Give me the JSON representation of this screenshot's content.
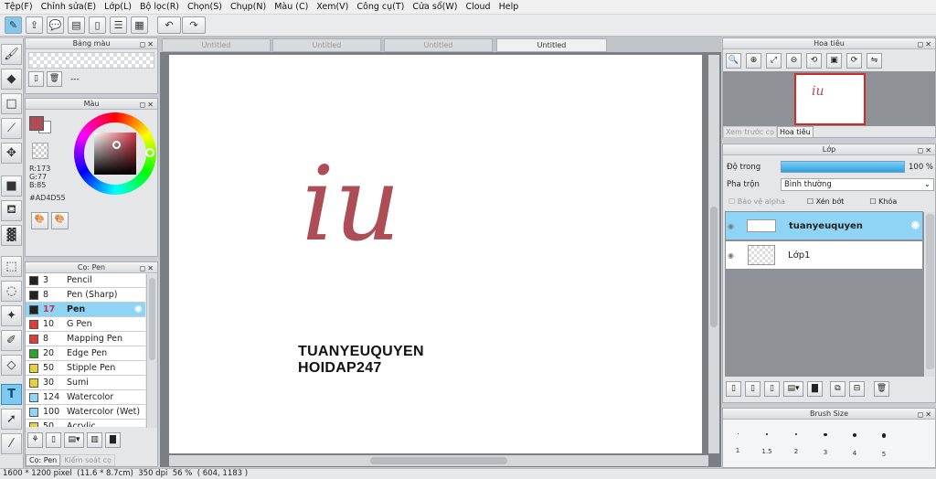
{
  "menu": [
    "Tệp(F)",
    "Chỉnh sửa(E)",
    "Lớp(L)",
    "Bộ lọc(R)",
    "Chọn(S)",
    "Chụp(N)",
    "Màu (C)",
    "Xem(V)",
    "Công cụ(T)",
    "Cửa sổ(W)",
    "Cloud",
    "Help"
  ],
  "doc_tabs": [
    "Untitled",
    "Untitled",
    "Untitled",
    "Untitled"
  ],
  "panels": {
    "swatch_title": "Bảng màu",
    "swatch_info": "---",
    "color_title": "Màu",
    "color_r": "R:173",
    "color_g": "G:77",
    "color_b": "B:85",
    "color_hex": "#AD4D55",
    "brush_title": "Cọ: Pen",
    "navigator_title": "Hoa tiêu",
    "nav_tab1": "Xem trước cọ",
    "nav_tab2": "Hoa tiêu",
    "layer_title": "Lớp",
    "opacity_label": "Độ trong",
    "opacity_value": "100 %",
    "blend_label": "Pha trộn",
    "blend_value": "Bình thường",
    "protect_alpha": "Bảo vệ alpha",
    "clipping": "Xén bớt",
    "lock": "Khóa",
    "brushsize_title": "Brush Size",
    "bottom_tab1": "Cọ: Pen",
    "bottom_tab2": "Kiểm soát cọ"
  },
  "opacity_fraction": 1.0,
  "brushes": [
    {
      "size": "3",
      "name": "Pencil",
      "color": "#222222"
    },
    {
      "size": "8",
      "name": "Pen (Sharp)",
      "color": "#222222"
    },
    {
      "size": "17",
      "name": "Pen",
      "color": "#222222",
      "selected": true
    },
    {
      "size": "10",
      "name": "G Pen",
      "color": "#e03a3a"
    },
    {
      "size": "8",
      "name": "Mapping Pen",
      "color": "#e03a3a"
    },
    {
      "size": "20",
      "name": "Edge Pen",
      "color": "#2fa32f"
    },
    {
      "size": "50",
      "name": "Stipple Pen",
      "color": "#e8d23a"
    },
    {
      "size": "30",
      "name": "Sumi",
      "color": "#e8d23a"
    },
    {
      "size": "124",
      "name": "Watercolor",
      "color": "#8fd6f5"
    },
    {
      "size": "100",
      "name": "Watercolor (Wet)",
      "color": "#8fd6f5"
    },
    {
      "size": "50",
      "name": "Acrylic",
      "color": "#e8d23a"
    }
  ],
  "layers": [
    {
      "name": "tuanyeuquyen",
      "selected": true
    },
    {
      "name": "Lớp1",
      "selected": false
    }
  ],
  "brush_sizes": [
    "1",
    "1.5",
    "2",
    "3",
    "4",
    "5"
  ],
  "canvas_text": {
    "big": "iu",
    "line1": "TUANYEUQUYEN",
    "line2": "HOIDAP247"
  },
  "colors": {
    "main": "#AD4D55",
    "accent": "#8fd4f5"
  },
  "status": {
    "dims": "1600 * 1200 pixel",
    "size": "(11.6 * 8.7cm)",
    "dpi": "350 dpi",
    "zoom": "56 %",
    "pos": "( 604, 1183 )"
  }
}
